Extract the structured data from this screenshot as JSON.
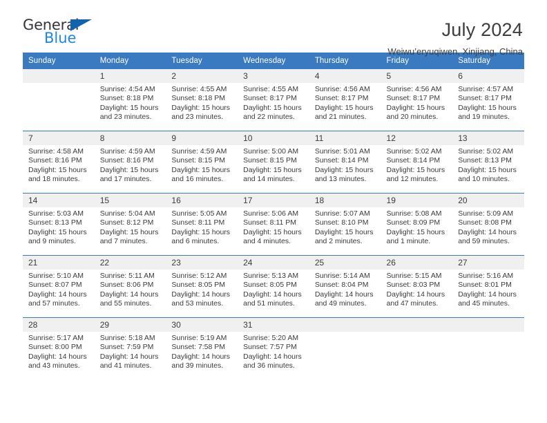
{
  "branding": {
    "logo_primary": "General",
    "logo_secondary": "Blue",
    "triangle_icon": "blue-triangle-icon"
  },
  "header": {
    "title": "July 2024",
    "subtitle": "Weiwu’eryuqiwen, Xinjiang, China"
  },
  "colors": {
    "header_blue": "#3a7ac0",
    "daynum_bg": "#f0f0f0",
    "text": "#3a3a3a",
    "logo_blue": "#1f86df",
    "triangle_blue": "#1263ad"
  },
  "weekday_headers": [
    "Sunday",
    "Monday",
    "Tuesday",
    "Wednesday",
    "Thursday",
    "Friday",
    "Saturday"
  ],
  "weeks": [
    [
      {
        "day": "",
        "sunrise": "",
        "sunset": "",
        "daylight": ""
      },
      {
        "day": "1",
        "sunrise": "Sunrise: 4:54 AM",
        "sunset": "Sunset: 8:18 PM",
        "daylight": "Daylight: 15 hours and 23 minutes."
      },
      {
        "day": "2",
        "sunrise": "Sunrise: 4:55 AM",
        "sunset": "Sunset: 8:18 PM",
        "daylight": "Daylight: 15 hours and 23 minutes."
      },
      {
        "day": "3",
        "sunrise": "Sunrise: 4:55 AM",
        "sunset": "Sunset: 8:17 PM",
        "daylight": "Daylight: 15 hours and 22 minutes."
      },
      {
        "day": "4",
        "sunrise": "Sunrise: 4:56 AM",
        "sunset": "Sunset: 8:17 PM",
        "daylight": "Daylight: 15 hours and 21 minutes."
      },
      {
        "day": "5",
        "sunrise": "Sunrise: 4:56 AM",
        "sunset": "Sunset: 8:17 PM",
        "daylight": "Daylight: 15 hours and 20 minutes."
      },
      {
        "day": "6",
        "sunrise": "Sunrise: 4:57 AM",
        "sunset": "Sunset: 8:17 PM",
        "daylight": "Daylight: 15 hours and 19 minutes."
      }
    ],
    [
      {
        "day": "7",
        "sunrise": "Sunrise: 4:58 AM",
        "sunset": "Sunset: 8:16 PM",
        "daylight": "Daylight: 15 hours and 18 minutes."
      },
      {
        "day": "8",
        "sunrise": "Sunrise: 4:59 AM",
        "sunset": "Sunset: 8:16 PM",
        "daylight": "Daylight: 15 hours and 17 minutes."
      },
      {
        "day": "9",
        "sunrise": "Sunrise: 4:59 AM",
        "sunset": "Sunset: 8:15 PM",
        "daylight": "Daylight: 15 hours and 16 minutes."
      },
      {
        "day": "10",
        "sunrise": "Sunrise: 5:00 AM",
        "sunset": "Sunset: 8:15 PM",
        "daylight": "Daylight: 15 hours and 14 minutes."
      },
      {
        "day": "11",
        "sunrise": "Sunrise: 5:01 AM",
        "sunset": "Sunset: 8:14 PM",
        "daylight": "Daylight: 15 hours and 13 minutes."
      },
      {
        "day": "12",
        "sunrise": "Sunrise: 5:02 AM",
        "sunset": "Sunset: 8:14 PM",
        "daylight": "Daylight: 15 hours and 12 minutes."
      },
      {
        "day": "13",
        "sunrise": "Sunrise: 5:02 AM",
        "sunset": "Sunset: 8:13 PM",
        "daylight": "Daylight: 15 hours and 10 minutes."
      }
    ],
    [
      {
        "day": "14",
        "sunrise": "Sunrise: 5:03 AM",
        "sunset": "Sunset: 8:13 PM",
        "daylight": "Daylight: 15 hours and 9 minutes."
      },
      {
        "day": "15",
        "sunrise": "Sunrise: 5:04 AM",
        "sunset": "Sunset: 8:12 PM",
        "daylight": "Daylight: 15 hours and 7 minutes."
      },
      {
        "day": "16",
        "sunrise": "Sunrise: 5:05 AM",
        "sunset": "Sunset: 8:11 PM",
        "daylight": "Daylight: 15 hours and 6 minutes."
      },
      {
        "day": "17",
        "sunrise": "Sunrise: 5:06 AM",
        "sunset": "Sunset: 8:11 PM",
        "daylight": "Daylight: 15 hours and 4 minutes."
      },
      {
        "day": "18",
        "sunrise": "Sunrise: 5:07 AM",
        "sunset": "Sunset: 8:10 PM",
        "daylight": "Daylight: 15 hours and 2 minutes."
      },
      {
        "day": "19",
        "sunrise": "Sunrise: 5:08 AM",
        "sunset": "Sunset: 8:09 PM",
        "daylight": "Daylight: 15 hours and 1 minute."
      },
      {
        "day": "20",
        "sunrise": "Sunrise: 5:09 AM",
        "sunset": "Sunset: 8:08 PM",
        "daylight": "Daylight: 14 hours and 59 minutes."
      }
    ],
    [
      {
        "day": "21",
        "sunrise": "Sunrise: 5:10 AM",
        "sunset": "Sunset: 8:07 PM",
        "daylight": "Daylight: 14 hours and 57 minutes."
      },
      {
        "day": "22",
        "sunrise": "Sunrise: 5:11 AM",
        "sunset": "Sunset: 8:06 PM",
        "daylight": "Daylight: 14 hours and 55 minutes."
      },
      {
        "day": "23",
        "sunrise": "Sunrise: 5:12 AM",
        "sunset": "Sunset: 8:05 PM",
        "daylight": "Daylight: 14 hours and 53 minutes."
      },
      {
        "day": "24",
        "sunrise": "Sunrise: 5:13 AM",
        "sunset": "Sunset: 8:05 PM",
        "daylight": "Daylight: 14 hours and 51 minutes."
      },
      {
        "day": "25",
        "sunrise": "Sunrise: 5:14 AM",
        "sunset": "Sunset: 8:04 PM",
        "daylight": "Daylight: 14 hours and 49 minutes."
      },
      {
        "day": "26",
        "sunrise": "Sunrise: 5:15 AM",
        "sunset": "Sunset: 8:03 PM",
        "daylight": "Daylight: 14 hours and 47 minutes."
      },
      {
        "day": "27",
        "sunrise": "Sunrise: 5:16 AM",
        "sunset": "Sunset: 8:01 PM",
        "daylight": "Daylight: 14 hours and 45 minutes."
      }
    ],
    [
      {
        "day": "28",
        "sunrise": "Sunrise: 5:17 AM",
        "sunset": "Sunset: 8:00 PM",
        "daylight": "Daylight: 14 hours and 43 minutes."
      },
      {
        "day": "29",
        "sunrise": "Sunrise: 5:18 AM",
        "sunset": "Sunset: 7:59 PM",
        "daylight": "Daylight: 14 hours and 41 minutes."
      },
      {
        "day": "30",
        "sunrise": "Sunrise: 5:19 AM",
        "sunset": "Sunset: 7:58 PM",
        "daylight": "Daylight: 14 hours and 39 minutes."
      },
      {
        "day": "31",
        "sunrise": "Sunrise: 5:20 AM",
        "sunset": "Sunset: 7:57 PM",
        "daylight": "Daylight: 14 hours and 36 minutes."
      },
      {
        "day": "",
        "sunrise": "",
        "sunset": "",
        "daylight": ""
      },
      {
        "day": "",
        "sunrise": "",
        "sunset": "",
        "daylight": ""
      },
      {
        "day": "",
        "sunrise": "",
        "sunset": "",
        "daylight": ""
      }
    ]
  ]
}
